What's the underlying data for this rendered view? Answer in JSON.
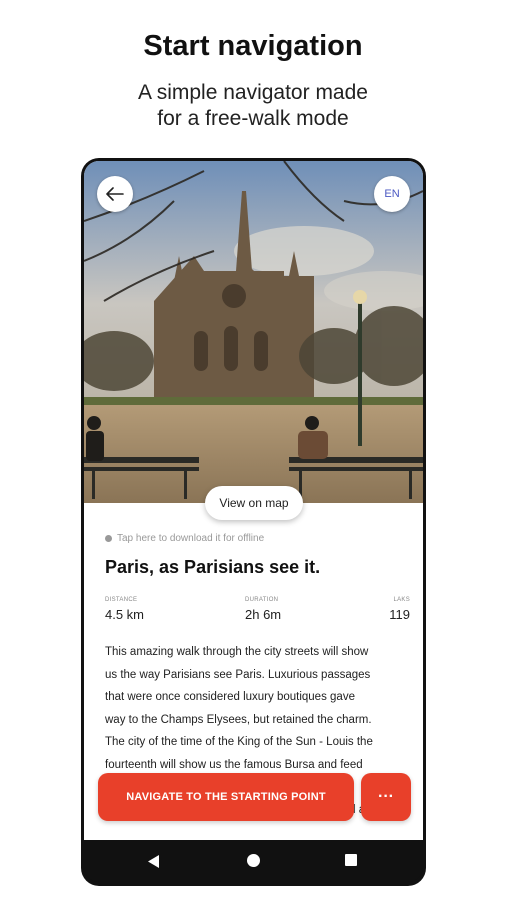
{
  "promo": {
    "title": "Start navigation",
    "subtitle_line1": "A simple navigator made",
    "subtitle_line2": "for a free-walk mode"
  },
  "header": {
    "back_icon": "arrow-left-icon",
    "language": "EN"
  },
  "hero": {
    "map_button": "View on map"
  },
  "tour": {
    "offline_hint": "Tap here to download it for offline",
    "title": "Paris, as Parisians see it.",
    "stats": {
      "distance_label": "DISTANCE",
      "distance_value": "4.5 km",
      "duration_label": "DURATION",
      "duration_value": "2h 6m",
      "langs_label": "LAKS",
      "langs_value": "119"
    },
    "description_lines": [
      "This amazing walk through the city streets will show",
      "us the way Parisians see Paris. Luxurious passages",
      "that were once considered luxury boutiques gave",
      "way to the Champs Elysees, but retained the charm.",
      "The city of the time of the King of the Sun - Louis the",
      "fourteenth will show us the famous Bursa and feed",
      "",
      "a monument similar to the Bronze Horseman and a"
    ]
  },
  "actions": {
    "navigate_label": "NAVIGATE TO THE STARTING POINT",
    "more_label": "···"
  },
  "colors": {
    "accent": "#e8402a",
    "lang_text": "#4a57c2"
  }
}
